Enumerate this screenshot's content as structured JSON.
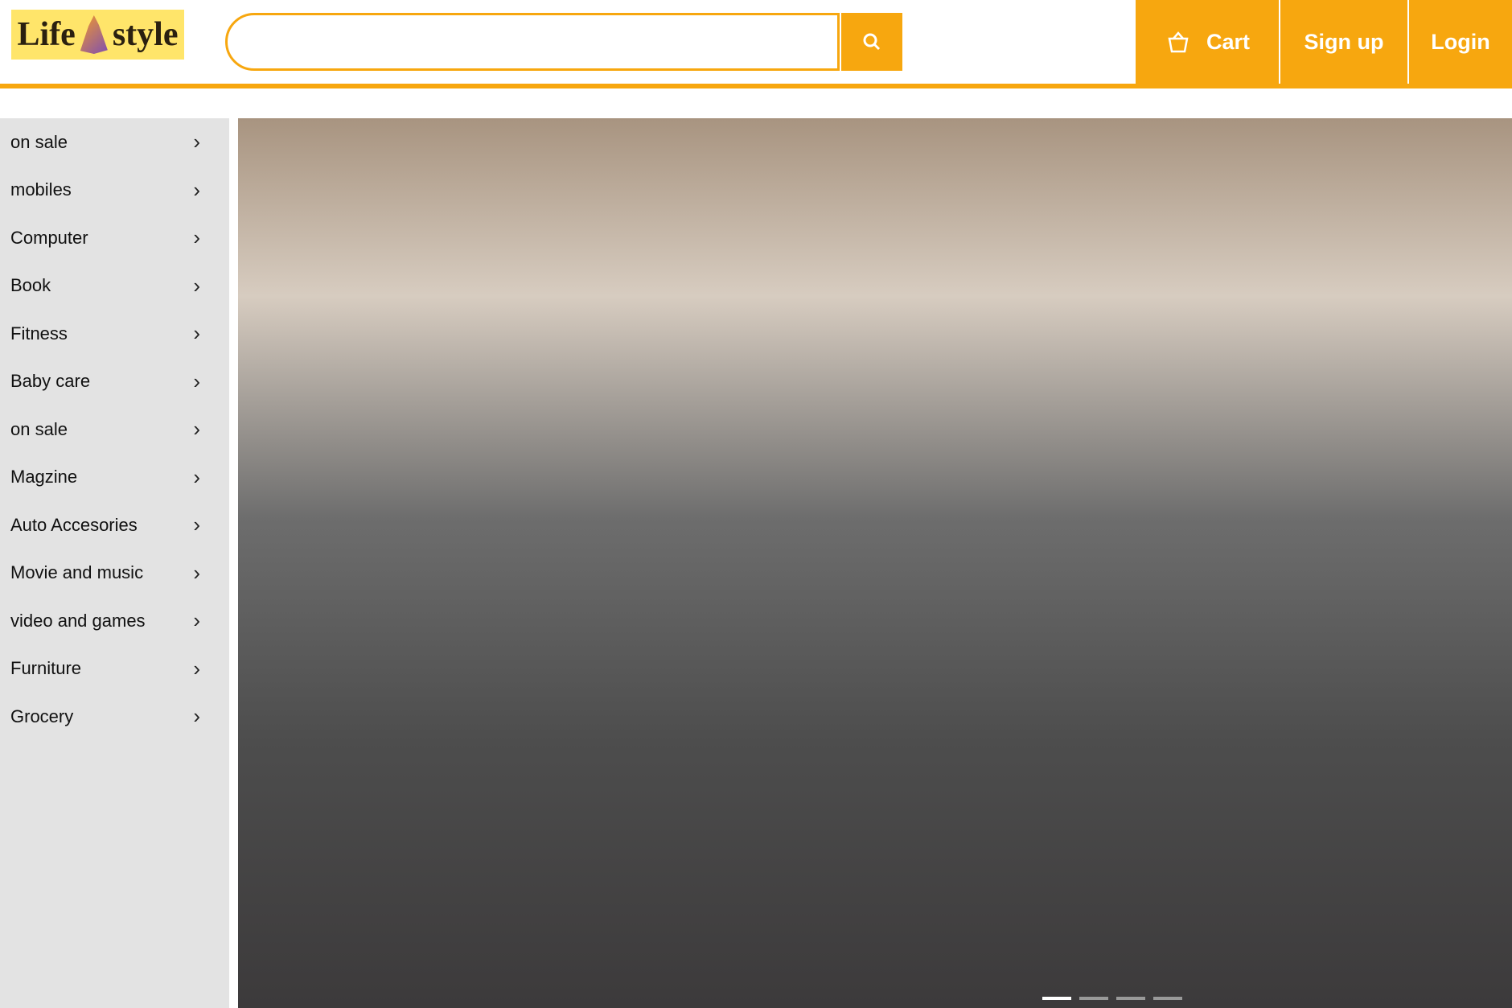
{
  "header": {
    "logo_left": "Life",
    "logo_right": "style",
    "search_placeholder": "",
    "nav": [
      "Cart",
      "Sign up",
      "Login"
    ]
  },
  "sidebar": {
    "items": [
      "on sale",
      "mobiles",
      "Computer",
      "Book",
      "Fitness",
      "Baby care",
      "on sale",
      "Magzine",
      "Auto Accesories",
      "Movie and music",
      "video and games",
      "Furniture",
      "Grocery"
    ]
  },
  "hero": {
    "slides": 4,
    "active_slide": 0
  },
  "colors": {
    "accent": "#f7a70f",
    "logo_bg": "#ffe56a",
    "sidebar_bg": "#e3e3e3"
  },
  "icons": [
    "search-icon",
    "cart-icon",
    "chevron-right-icon"
  ]
}
